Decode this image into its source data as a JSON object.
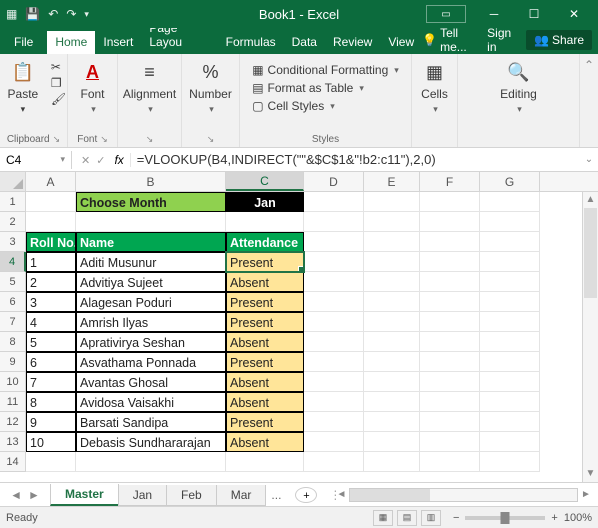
{
  "title": "Book1 - Excel",
  "menu": {
    "file": "File",
    "home": "Home",
    "insert": "Insert",
    "page": "Page Layou",
    "formulas": "Formulas",
    "data": "Data",
    "review": "Review",
    "view": "View",
    "tell": "Tell me...",
    "signin": "Sign in",
    "share": "Share"
  },
  "ribbon": {
    "clipboard": {
      "paste": "Paste",
      "label": "Clipboard"
    },
    "font": {
      "btn": "Font",
      "label": "Font"
    },
    "alignment": {
      "btn": "Alignment",
      "label": ""
    },
    "number": {
      "btn": "Number",
      "label": ""
    },
    "styles": {
      "cond": "Conditional Formatting",
      "table": "Format as Table",
      "cell": "Cell Styles",
      "label": "Styles"
    },
    "cells": {
      "btn": "Cells",
      "label": ""
    },
    "editing": {
      "btn": "Editing",
      "label": ""
    }
  },
  "namebox": "C4",
  "formula": "=VLOOKUP(B4,INDIRECT(\"\"&$C$1&\"!b2:c11\"),2,0)",
  "cols": [
    "A",
    "B",
    "C",
    "D",
    "E",
    "F",
    "G"
  ],
  "colwidths": [
    "cA",
    "cB",
    "cC",
    "cD",
    "cE",
    "cF",
    "cG"
  ],
  "activeCol": "C",
  "activeRow": 4,
  "r1": {
    "b": "Choose Month",
    "c": "Jan"
  },
  "r3": {
    "a": "Roll No.",
    "b": "Name",
    "c": "Attendance"
  },
  "rows": [
    {
      "n": "4",
      "a": "1",
      "b": "Aditi Musunur",
      "c": "Present"
    },
    {
      "n": "5",
      "a": "2",
      "b": "Advitiya Sujeet",
      "c": "Absent"
    },
    {
      "n": "6",
      "a": "3",
      "b": "Alagesan Poduri",
      "c": "Present"
    },
    {
      "n": "7",
      "a": "4",
      "b": "Amrish Ilyas",
      "c": "Present"
    },
    {
      "n": "8",
      "a": "5",
      "b": "Aprativirya Seshan",
      "c": "Absent"
    },
    {
      "n": "9",
      "a": "6",
      "b": "Asvathama Ponnada",
      "c": "Present"
    },
    {
      "n": "10",
      "a": "7",
      "b": "Avantas Ghosal",
      "c": "Absent"
    },
    {
      "n": "11",
      "a": "8",
      "b": "Avidosa Vaisakhi",
      "c": "Absent"
    },
    {
      "n": "12",
      "a": "9",
      "b": "Barsati Sandipa",
      "c": "Present"
    },
    {
      "n": "13",
      "a": "10",
      "b": "Debasis Sundhararajan",
      "c": "Absent"
    }
  ],
  "sheets": {
    "active": "Master",
    "others": [
      "Jan",
      "Feb",
      "Mar"
    ],
    "more": "..."
  },
  "status": {
    "ready": "Ready",
    "zoom": "100%"
  }
}
